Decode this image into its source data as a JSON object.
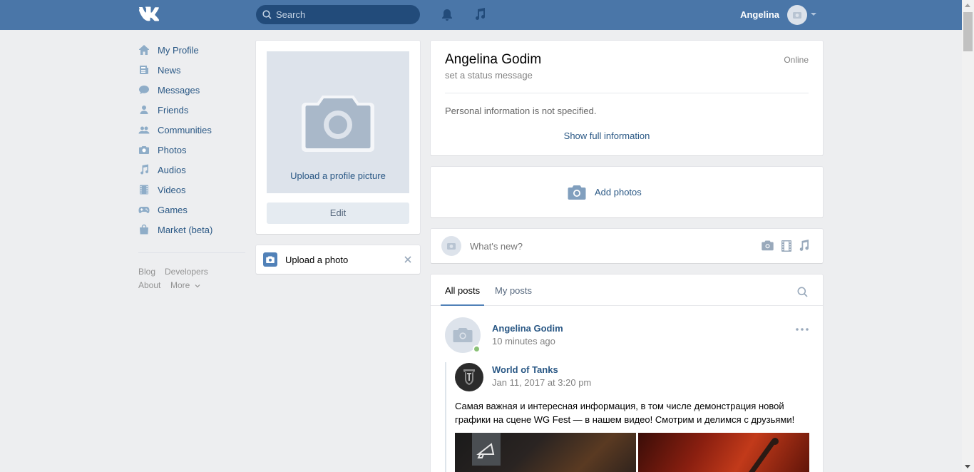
{
  "header": {
    "search_placeholder": "Search",
    "user_name": "Angelina"
  },
  "nav": {
    "items": [
      {
        "label": "My Profile",
        "icon": "home-icon"
      },
      {
        "label": "News",
        "icon": "news-icon"
      },
      {
        "label": "Messages",
        "icon": "messages-icon"
      },
      {
        "label": "Friends",
        "icon": "friends-icon"
      },
      {
        "label": "Communities",
        "icon": "communities-icon"
      },
      {
        "label": "Photos",
        "icon": "camera-icon"
      },
      {
        "label": "Audios",
        "icon": "music-note-icon"
      },
      {
        "label": "Videos",
        "icon": "film-icon"
      },
      {
        "label": "Games",
        "icon": "gamepad-icon"
      },
      {
        "label": "Market (beta)",
        "icon": "bag-icon"
      }
    ],
    "footer": {
      "blog": "Blog",
      "developers": "Developers",
      "about": "About",
      "more": "More"
    }
  },
  "avatar": {
    "upload_label": "Upload a profile picture",
    "edit_label": "Edit"
  },
  "upload_photo": {
    "label": "Upload a photo"
  },
  "profile": {
    "name": "Angelina Godim",
    "status": "set a status message",
    "presence": "Online",
    "info_note": "Personal information is not specified.",
    "show_full": "Show full information"
  },
  "add_photos": {
    "label": "Add photos"
  },
  "composer": {
    "placeholder": "What's new?"
  },
  "feed": {
    "tabs": [
      "All posts",
      "My posts"
    ],
    "post": {
      "author": "Angelina Godim",
      "time": "10 minutes ago",
      "repost": {
        "source": "World of Tanks",
        "date": "Jan 11, 2017 at 3:20 pm",
        "text_line1": "Самая важная и интересная информация, в том числе демонстрация новой",
        "text_line2": "графики на сцене WG Fest — в нашем видео! Смотрим и делимся с друзьями!"
      }
    }
  },
  "colors": {
    "header": "#4a76a8",
    "link": "#2a5885",
    "background": "#edeef0",
    "online": "#8ac176"
  }
}
